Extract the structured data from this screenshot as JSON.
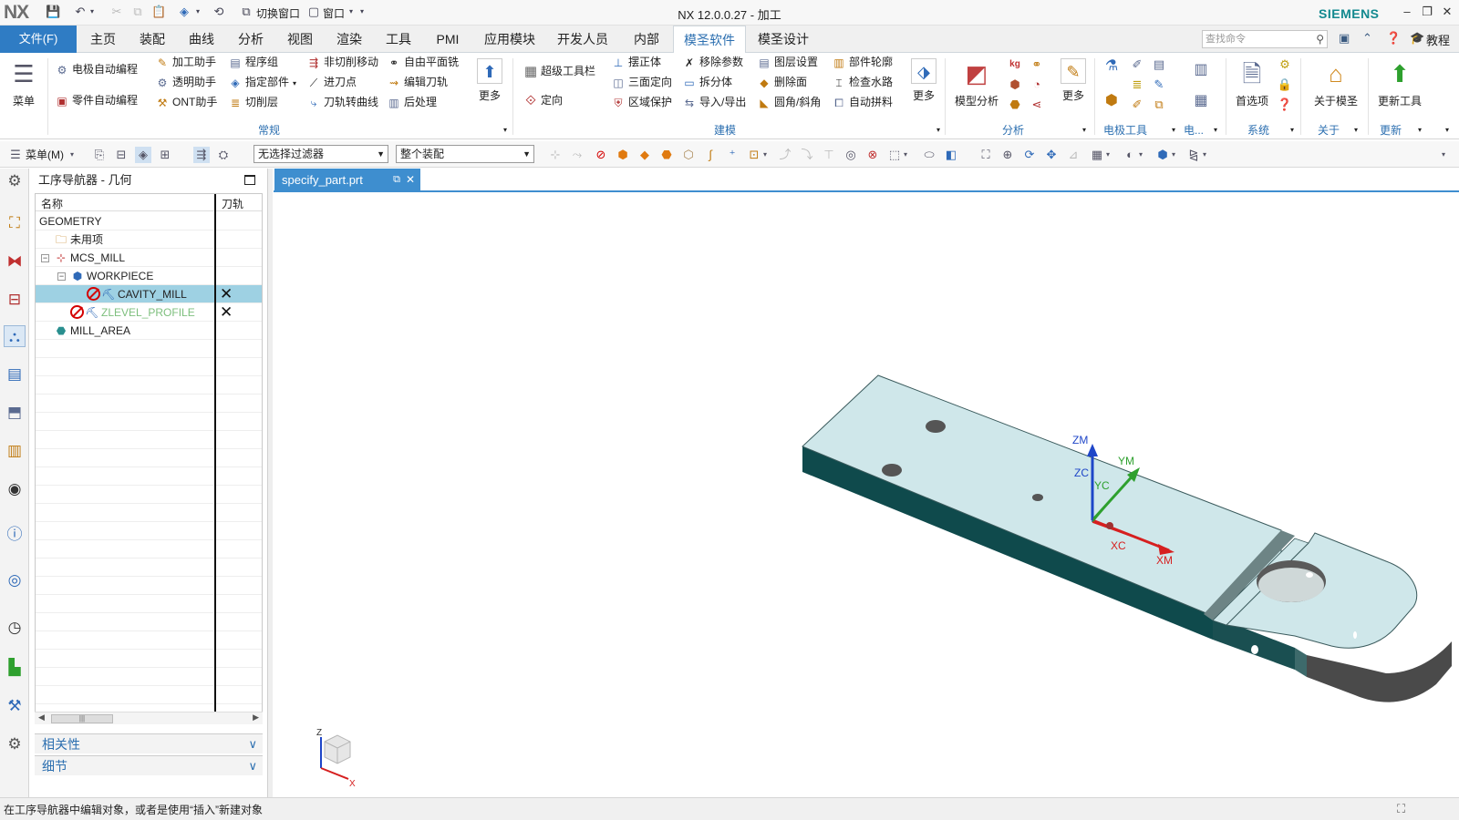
{
  "window": {
    "logo": "NX",
    "title": "NX 12.0.0.27 - 加工",
    "brand": "SIEMENS",
    "quick_switch_window": "切换窗口",
    "quick_window": "窗口"
  },
  "menubar": {
    "file_label": "文件(F)",
    "tabs": [
      "主页",
      "装配",
      "曲线",
      "分析",
      "视图",
      "渲染",
      "工具",
      "PMI",
      "应用模块",
      "开发人员",
      "内部",
      "模圣软件",
      "模圣设计"
    ],
    "active_tab": "模圣软件",
    "search_placeholder": "查找命令",
    "tutorial_label": "教程"
  },
  "ribbon": {
    "menu_label": "菜单",
    "g1": {
      "electrode_auto": "电极自动编程",
      "part_auto": "零件自动编程",
      "machining_helper": "加工助手",
      "transparent_helper": "透明助手",
      "ont_helper": "ONT助手",
      "program_group": "程序组",
      "specify_part": "指定部件",
      "cut_layer": "切削层",
      "non_cut_move": "非切削移动",
      "entry_point": "进刀点",
      "toolpath_to_curve": "刀轨转曲线",
      "free_face_mill": "自由平面铣",
      "edit_toolpath": "编辑刀轨",
      "postprocess": "后处理",
      "more": "更多",
      "group_label": "常规"
    },
    "g2": {
      "super_toolbar": "超级工具栏",
      "orient": "定向",
      "straighten_body": "摆正体",
      "three_face_orient": "三面定向",
      "region_protect": "区域保护",
      "remove_params": "移除参数",
      "split_body": "拆分体",
      "import_export": "导入/导出",
      "layer_settings": "图层设置",
      "delete_face": "删除面",
      "fillet_chamfer": "圆角/斜角",
      "part_outline": "部件轮廓",
      "check_waterway": "检查水路",
      "auto_stitch": "自动拼料",
      "more": "更多",
      "group_label": "建模"
    },
    "g3": {
      "model_analysis": "模型分析",
      "more": "更多",
      "group_label": "分析"
    },
    "g4": {
      "group_label": "电极工具",
      "electric_short": "电..."
    },
    "g5": {
      "preferences": "首选项",
      "group_label": "系统"
    },
    "g6": {
      "about": "关于模圣",
      "group_label": "关于"
    },
    "g7": {
      "update_tools": "更新工具",
      "group_label": "更新"
    }
  },
  "toolbar2": {
    "menu_label": "菜单(M)",
    "filter_value": "无选择过滤器",
    "assembly_value": "整个装配"
  },
  "navigator": {
    "title": "工序导航器 - 几何",
    "col_name": "名称",
    "col_toolpath": "刀轨",
    "rows": [
      {
        "label": "GEOMETRY"
      },
      {
        "label": "未用项"
      },
      {
        "label": "MCS_MILL"
      },
      {
        "label": "WORKPIECE"
      },
      {
        "label": "CAVITY_MILL",
        "mark": "✕"
      },
      {
        "label": "ZLEVEL_PROFILE",
        "mark": "✕"
      },
      {
        "label": "MILL_AREA"
      }
    ],
    "section_dependencies": "相关性",
    "section_details": "细节"
  },
  "document": {
    "tab_label": "specify_part.prt"
  },
  "viewport": {
    "triad_labels": {
      "zm": "ZM",
      "zc": "ZC",
      "ym": "YM",
      "yc": "YC",
      "xc": "XC",
      "xm": "XM"
    },
    "mini_triad": {
      "z": "Z",
      "x": "X"
    }
  },
  "status": {
    "message": "在工序导航器中编辑对象，或者是使用“插入”新建对象"
  },
  "colors": {
    "accent": "#2f7cc4",
    "selection": "#9ed1e3",
    "part_top": "#cfe7ea",
    "part_side": "#0f4a4c",
    "axis_x": "#d61f1f",
    "axis_y": "#2ea02e",
    "axis_z": "#1f46c8"
  }
}
